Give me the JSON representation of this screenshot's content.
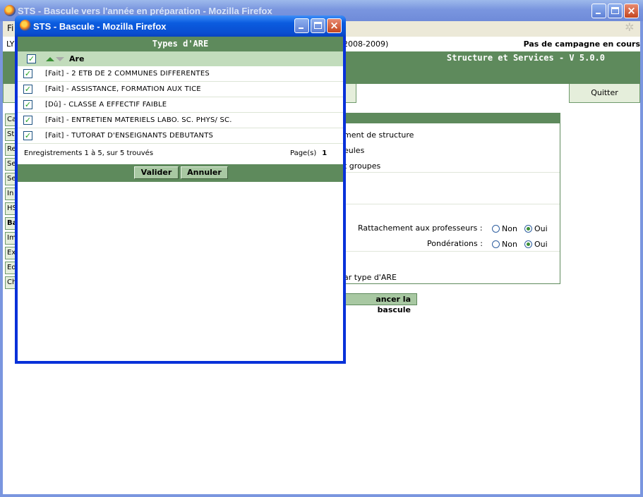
{
  "main_window": {
    "title": "STS - Bascule vers l'année en préparation - Mozilla Firefox",
    "menu_first": "Fi",
    "school_prefix": "LY",
    "year_fragment": "2008-2009)",
    "campaign_status": "Pas de campagne en cours",
    "app_title": "Structure et Services - V 5.0.0",
    "quit_tab": "Quitter",
    "side_nav": [
      "Ca",
      "St",
      "Re",
      "Se",
      "Se",
      "In",
      "HS",
      "Ba",
      "Im",
      "Ex",
      "Ed",
      "Ch"
    ],
    "side_nav_active_index": 7,
    "panel": {
      "line1": "ment de structure",
      "line2": "eules",
      "line3": "t groupes",
      "rattachement_label": "Rattachement aux professeurs :",
      "ponderations_label": "Pondérations :",
      "option_non": "Non",
      "option_oui": "Oui",
      "rattachement_value": "Oui",
      "ponderations_value": "Oui",
      "par_type": "ar type d'ARE"
    },
    "bascule_button": "ancer la bascule"
  },
  "popup": {
    "title": "STS - Bascule - Mozilla Firefox",
    "header": "Types d'ARE",
    "column_label": "Are",
    "select_all_checked": true,
    "rows": [
      {
        "label": "[Fait] - 2 ETB DE 2 COMMUNES DIFFERENTES",
        "checked": true
      },
      {
        "label": "[Fait] - ASSISTANCE, FORMATION AUX TICE",
        "checked": true
      },
      {
        "label": "[Dû] - CLASSE A EFFECTIF FAIBLE",
        "checked": true
      },
      {
        "label": "[Fait] - ENTRETIEN MATERIELS LABO. SC. PHYS/ SC.",
        "checked": true
      },
      {
        "label": "[Fait] - TUTORAT D'ENSEIGNANTS DEBUTANTS",
        "checked": true
      }
    ],
    "records_text": "Enregistrements 1 à 5, sur 5 trouvés",
    "pages_label": "Page(s)",
    "page_number": "1",
    "validate_button": "Valider",
    "cancel_button": "Annuler"
  },
  "colors": {
    "app_green": "#5e8a5c",
    "header_light_green": "#c2dcbc",
    "button_green": "#a8c8a2",
    "xp_active_blue": "#0831d9",
    "xp_inactive_blue": "#7a96df"
  }
}
